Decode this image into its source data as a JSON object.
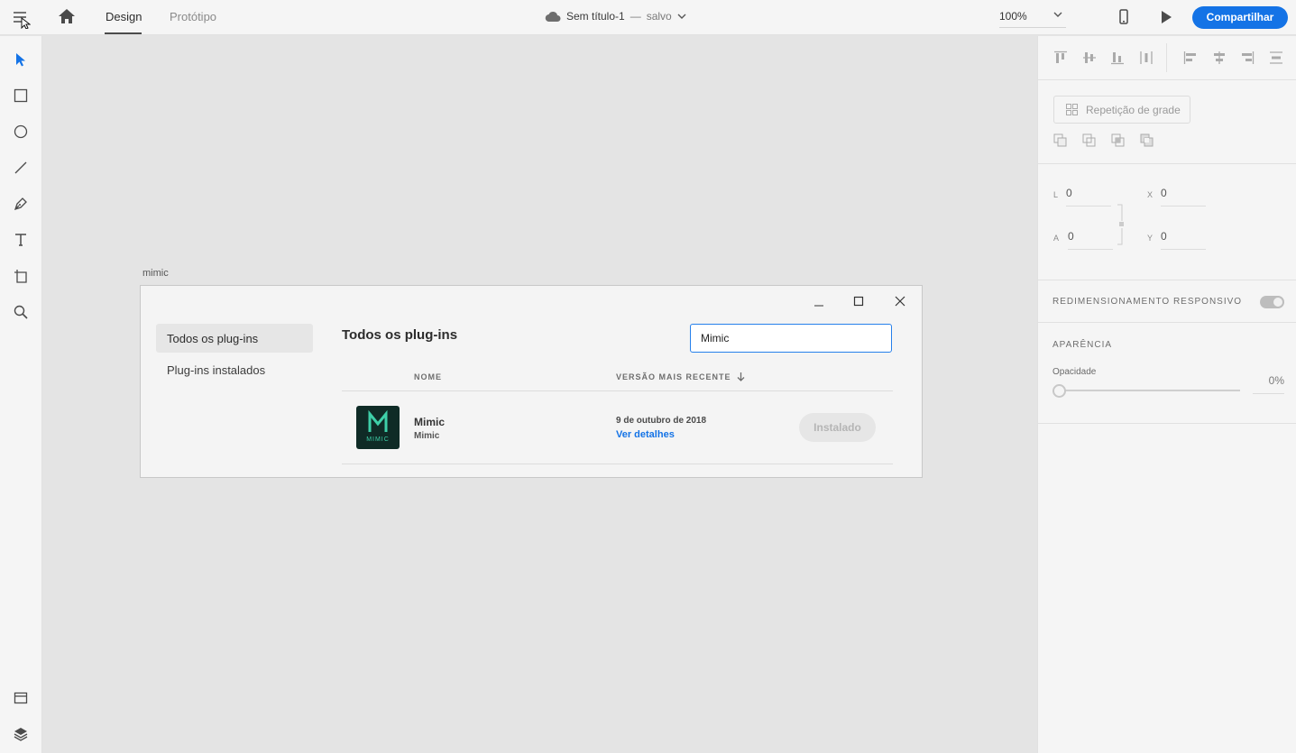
{
  "header": {
    "tab_design": "Design",
    "tab_prototype": "Protótipo",
    "doc_name": "Sem título-1",
    "doc_separator": "—",
    "doc_status": "salvo",
    "zoom": "100%",
    "share_label": "Compartilhar"
  },
  "canvas": {
    "artboard_label": "mimic"
  },
  "plugins_dialog": {
    "sidebar_all": "Todos os plug-ins",
    "sidebar_installed": "Plug-ins instalados",
    "title": "Todos os plug-ins",
    "search_value": "Mimic",
    "col_name": "NOME",
    "col_version": "VERSÃO MAIS RECENTE",
    "plugin": {
      "logo_text": "MIMIC",
      "name": "Mimic",
      "author": "Mimic",
      "date": "9 de outubro de 2018",
      "details_link": "Ver detalhes",
      "status_button": "Instalado"
    }
  },
  "properties": {
    "grid_repeat": "Repetição de grade",
    "width_label": "L",
    "width_value": "0",
    "x_label": "X",
    "x_value": "0",
    "height_label": "A",
    "height_value": "0",
    "y_label": "Y",
    "y_value": "0",
    "responsive_label": "REDIMENSIONAMENTO RESPONSIVO",
    "appearance_label": "APARÊNCIA",
    "opacity_label": "Opacidade",
    "opacity_value": "0%"
  },
  "colors": {
    "accent": "#1473e6",
    "plugin_logo_bg": "#0f2b26",
    "plugin_logo_fg": "#3ecfa8"
  }
}
